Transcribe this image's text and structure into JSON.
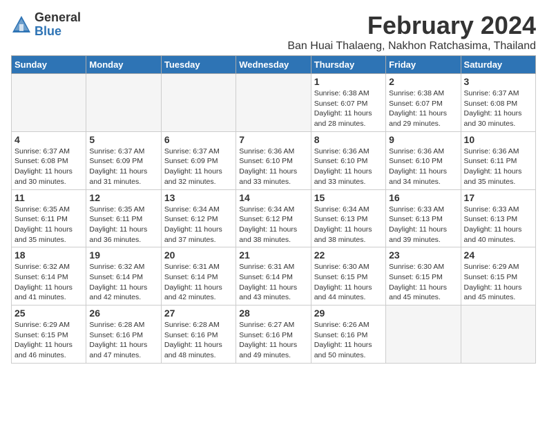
{
  "logo": {
    "general": "General",
    "blue": "Blue"
  },
  "title": "February 2024",
  "subtitle": "Ban Huai Thalaeng, Nakhon Ratchasima, Thailand",
  "days_of_week": [
    "Sunday",
    "Monday",
    "Tuesday",
    "Wednesday",
    "Thursday",
    "Friday",
    "Saturday"
  ],
  "weeks": [
    [
      {
        "day": "",
        "info": ""
      },
      {
        "day": "",
        "info": ""
      },
      {
        "day": "",
        "info": ""
      },
      {
        "day": "",
        "info": ""
      },
      {
        "day": "1",
        "info": "Sunrise: 6:38 AM\nSunset: 6:07 PM\nDaylight: 11 hours\nand 28 minutes."
      },
      {
        "day": "2",
        "info": "Sunrise: 6:38 AM\nSunset: 6:07 PM\nDaylight: 11 hours\nand 29 minutes."
      },
      {
        "day": "3",
        "info": "Sunrise: 6:37 AM\nSunset: 6:08 PM\nDaylight: 11 hours\nand 30 minutes."
      }
    ],
    [
      {
        "day": "4",
        "info": "Sunrise: 6:37 AM\nSunset: 6:08 PM\nDaylight: 11 hours\nand 30 minutes."
      },
      {
        "day": "5",
        "info": "Sunrise: 6:37 AM\nSunset: 6:09 PM\nDaylight: 11 hours\nand 31 minutes."
      },
      {
        "day": "6",
        "info": "Sunrise: 6:37 AM\nSunset: 6:09 PM\nDaylight: 11 hours\nand 32 minutes."
      },
      {
        "day": "7",
        "info": "Sunrise: 6:36 AM\nSunset: 6:10 PM\nDaylight: 11 hours\nand 33 minutes."
      },
      {
        "day": "8",
        "info": "Sunrise: 6:36 AM\nSunset: 6:10 PM\nDaylight: 11 hours\nand 33 minutes."
      },
      {
        "day": "9",
        "info": "Sunrise: 6:36 AM\nSunset: 6:10 PM\nDaylight: 11 hours\nand 34 minutes."
      },
      {
        "day": "10",
        "info": "Sunrise: 6:36 AM\nSunset: 6:11 PM\nDaylight: 11 hours\nand 35 minutes."
      }
    ],
    [
      {
        "day": "11",
        "info": "Sunrise: 6:35 AM\nSunset: 6:11 PM\nDaylight: 11 hours\nand 35 minutes."
      },
      {
        "day": "12",
        "info": "Sunrise: 6:35 AM\nSunset: 6:11 PM\nDaylight: 11 hours\nand 36 minutes."
      },
      {
        "day": "13",
        "info": "Sunrise: 6:34 AM\nSunset: 6:12 PM\nDaylight: 11 hours\nand 37 minutes."
      },
      {
        "day": "14",
        "info": "Sunrise: 6:34 AM\nSunset: 6:12 PM\nDaylight: 11 hours\nand 38 minutes."
      },
      {
        "day": "15",
        "info": "Sunrise: 6:34 AM\nSunset: 6:13 PM\nDaylight: 11 hours\nand 38 minutes."
      },
      {
        "day": "16",
        "info": "Sunrise: 6:33 AM\nSunset: 6:13 PM\nDaylight: 11 hours\nand 39 minutes."
      },
      {
        "day": "17",
        "info": "Sunrise: 6:33 AM\nSunset: 6:13 PM\nDaylight: 11 hours\nand 40 minutes."
      }
    ],
    [
      {
        "day": "18",
        "info": "Sunrise: 6:32 AM\nSunset: 6:14 PM\nDaylight: 11 hours\nand 41 minutes."
      },
      {
        "day": "19",
        "info": "Sunrise: 6:32 AM\nSunset: 6:14 PM\nDaylight: 11 hours\nand 42 minutes."
      },
      {
        "day": "20",
        "info": "Sunrise: 6:31 AM\nSunset: 6:14 PM\nDaylight: 11 hours\nand 42 minutes."
      },
      {
        "day": "21",
        "info": "Sunrise: 6:31 AM\nSunset: 6:14 PM\nDaylight: 11 hours\nand 43 minutes."
      },
      {
        "day": "22",
        "info": "Sunrise: 6:30 AM\nSunset: 6:15 PM\nDaylight: 11 hours\nand 44 minutes."
      },
      {
        "day": "23",
        "info": "Sunrise: 6:30 AM\nSunset: 6:15 PM\nDaylight: 11 hours\nand 45 minutes."
      },
      {
        "day": "24",
        "info": "Sunrise: 6:29 AM\nSunset: 6:15 PM\nDaylight: 11 hours\nand 45 minutes."
      }
    ],
    [
      {
        "day": "25",
        "info": "Sunrise: 6:29 AM\nSunset: 6:15 PM\nDaylight: 11 hours\nand 46 minutes."
      },
      {
        "day": "26",
        "info": "Sunrise: 6:28 AM\nSunset: 6:16 PM\nDaylight: 11 hours\nand 47 minutes."
      },
      {
        "day": "27",
        "info": "Sunrise: 6:28 AM\nSunset: 6:16 PM\nDaylight: 11 hours\nand 48 minutes."
      },
      {
        "day": "28",
        "info": "Sunrise: 6:27 AM\nSunset: 6:16 PM\nDaylight: 11 hours\nand 49 minutes."
      },
      {
        "day": "29",
        "info": "Sunrise: 6:26 AM\nSunset: 6:16 PM\nDaylight: 11 hours\nand 50 minutes."
      },
      {
        "day": "",
        "info": ""
      },
      {
        "day": "",
        "info": ""
      }
    ]
  ]
}
